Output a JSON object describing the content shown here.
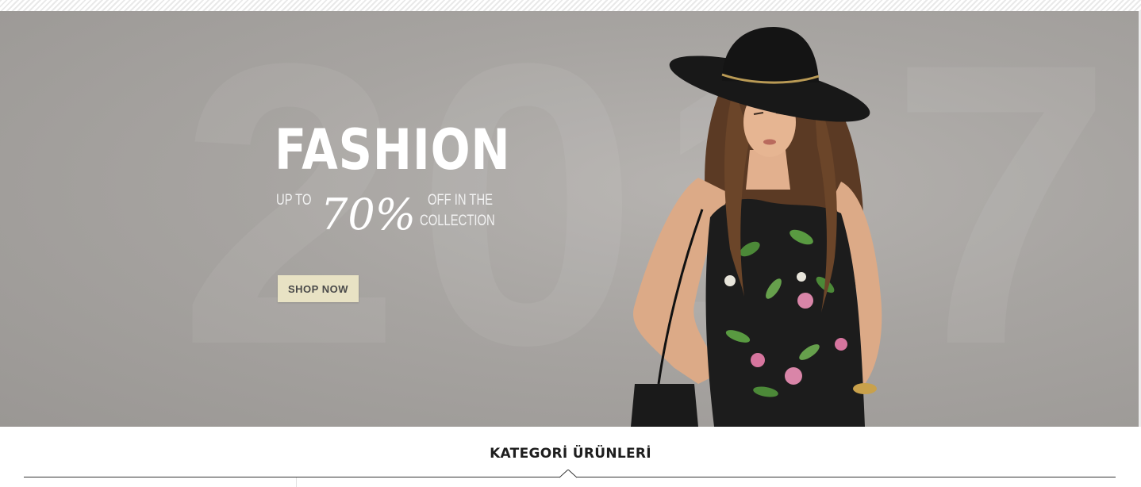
{
  "hero": {
    "background_text": "2017",
    "title": "FASHION",
    "up_to": "UP TO",
    "percent": "70%",
    "off_line": "OFF IN THE",
    "collection_line": "COLLECTION",
    "button_label": "SHOP NOW"
  },
  "section": {
    "title": "KATEGORİ ÜRÜNLERİ"
  },
  "colors": {
    "hero_background": "#a7a4a1",
    "button_background": "#e8e2c4",
    "title_text": "#1e1e1e"
  }
}
